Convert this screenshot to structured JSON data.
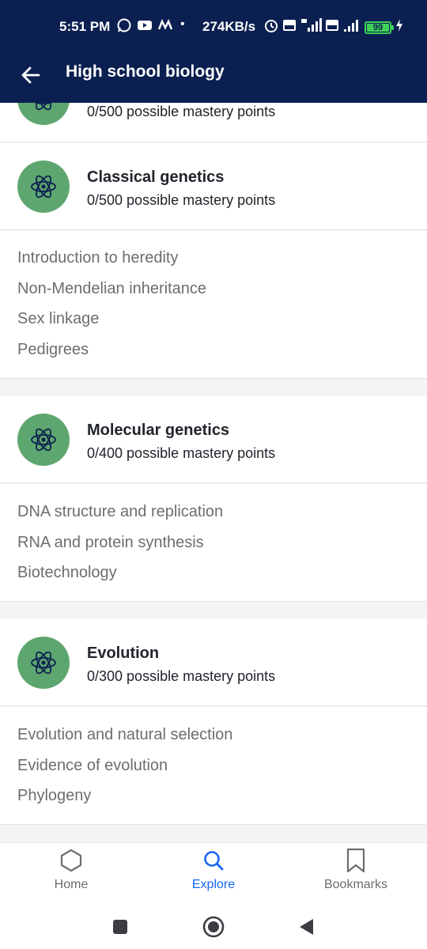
{
  "status_bar": {
    "time": "5:51 PM",
    "speed": "274KB/s",
    "battery": "99",
    "battery_level_percent": 99
  },
  "app_bar": {
    "title": "High school biology"
  },
  "units": [
    {
      "title": "",
      "points": "0/500 possible mastery points",
      "lessons": []
    },
    {
      "title": "Classical genetics",
      "points": "0/500 possible mastery points",
      "lessons": [
        "Introduction to heredity",
        "Non-Mendelian inheritance",
        "Sex linkage",
        "Pedigrees"
      ]
    },
    {
      "title": "Molecular genetics",
      "points": "0/400 possible mastery points",
      "lessons": [
        "DNA structure and replication",
        "RNA and protein synthesis",
        "Biotechnology"
      ]
    },
    {
      "title": "Evolution",
      "points": "0/300 possible mastery points",
      "lessons": [
        "Evolution and natural selection",
        "Evidence of evolution",
        "Phylogeny"
      ]
    }
  ],
  "bottom_nav": {
    "items": [
      {
        "label": "Home",
        "icon": "hexagon-icon",
        "active": false
      },
      {
        "label": "Explore",
        "icon": "search-icon",
        "active": true
      },
      {
        "label": "Bookmarks",
        "icon": "bookmark-icon",
        "active": false
      }
    ]
  },
  "colors": {
    "header_bg": "#0b2051",
    "unit_icon_bg": "#5ea66f",
    "active_accent": "#1865f2",
    "battery_green": "#3fd15a"
  }
}
